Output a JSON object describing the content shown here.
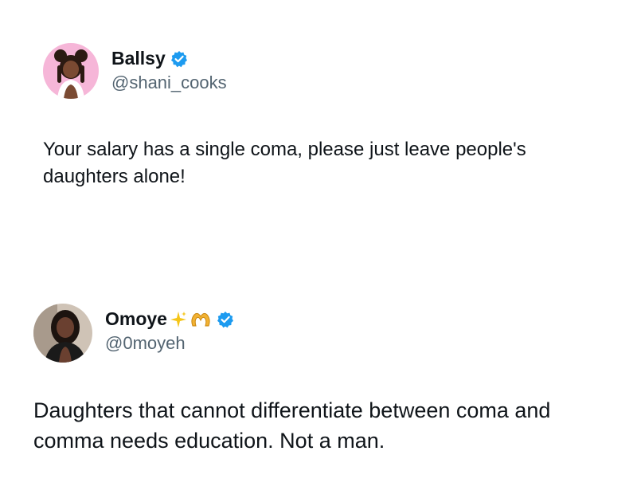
{
  "tweets": [
    {
      "display_name": "Ballsy",
      "handle": "@shani_cooks",
      "verified": true,
      "avatar_icon": "avatar-illustration-girl-with-buns",
      "text": "Your salary has a single coma, please just leave people's daughters alone!"
    },
    {
      "display_name": "Omoye",
      "handle": "@0moyeh",
      "verified": true,
      "name_emojis": [
        "sparkles-icon",
        "heart-hands-icon"
      ],
      "avatar_icon": "avatar-photo-woman",
      "text": "Daughters that cannot differentiate between coma and comma needs education. Not a man."
    }
  ],
  "colors": {
    "verified_blue": "#1d9bf0",
    "text": "#0f1419",
    "secondary_text": "#536471",
    "avatar1_bg": "#f6b6d8"
  }
}
